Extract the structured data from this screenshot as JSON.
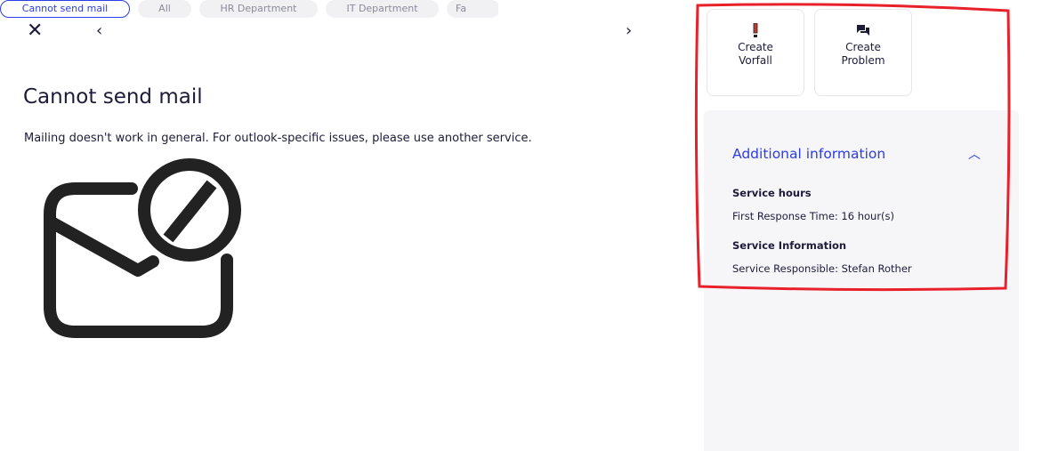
{
  "header": {
    "close_icon": "close-icon",
    "prev_icon": "chevron-left-icon",
    "next_icon": "chevron-right-icon",
    "tabs": [
      {
        "label": "Cannot send mail",
        "active": true
      },
      {
        "label": "All"
      },
      {
        "label": "HR Department"
      },
      {
        "label": "IT Department"
      },
      {
        "label": "Fa"
      }
    ]
  },
  "main": {
    "title": "Cannot send mail",
    "description": "Mailing doesn't work in general. For outlook-specific issues, please use another service.",
    "illustration": "mail-blocked-icon"
  },
  "actions": [
    {
      "line1": "Create",
      "line2": "Vorfall",
      "icon": "exclamation-icon",
      "icon_color": "#c0392b"
    },
    {
      "line1": "Create",
      "line2": "Problem",
      "icon": "chat-bubbles-icon",
      "icon_color": "#1c1c3a"
    }
  ],
  "info": {
    "title": "Additional information",
    "service_hours_label": "Service hours",
    "service_hours_value": "First Response Time: 16 hour(s)",
    "service_info_label": "Service Information",
    "service_info_value": "Service Responsible: Stefan Rother"
  },
  "colors": {
    "accent": "#2b3ce8",
    "annotation": "#e8202a"
  }
}
